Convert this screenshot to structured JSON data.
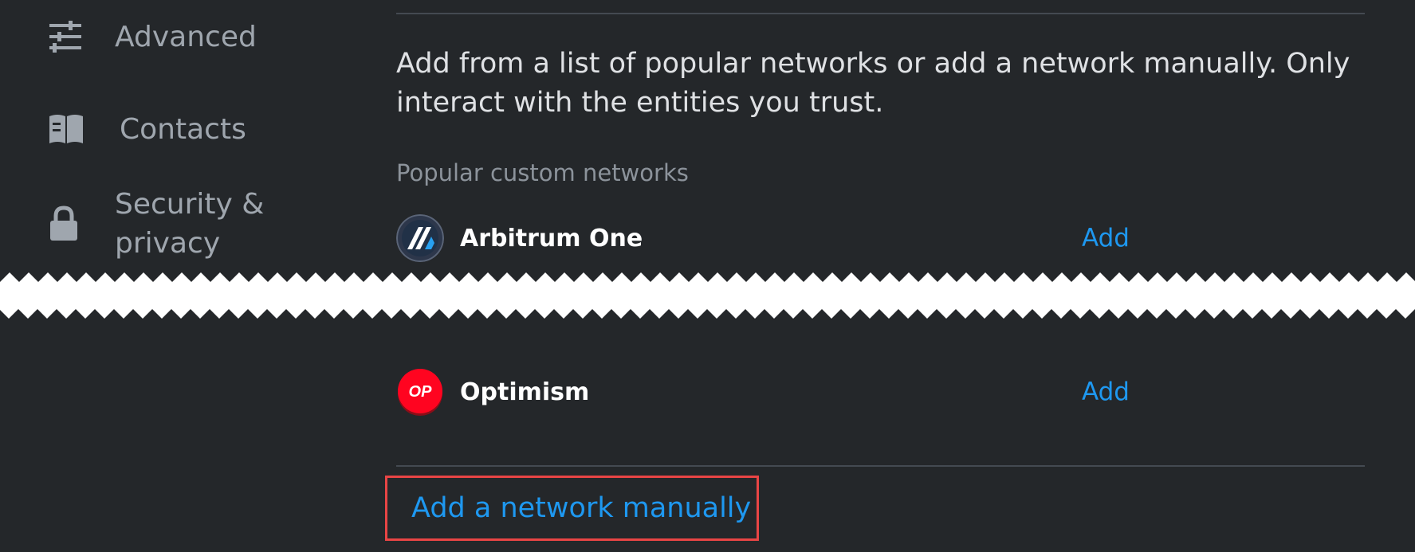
{
  "sidebar": {
    "items": [
      {
        "label": "Advanced",
        "icon": "sliders-icon"
      },
      {
        "label": "Contacts",
        "icon": "book-icon"
      },
      {
        "label_line1": "Security &",
        "label_line2": "privacy",
        "icon": "lock-icon"
      }
    ]
  },
  "main": {
    "intro": "Add from a list of popular networks or add a network manually. Only interact with the entities you trust.",
    "section_label": "Popular custom networks",
    "networks": [
      {
        "name": "Arbitrum One",
        "action": "Add",
        "icon": "arbitrum-logo"
      },
      {
        "name": "Optimism",
        "action": "Add",
        "icon": "optimism-logo",
        "logo_text": "OP"
      }
    ],
    "manual_link": "Add a network manually"
  },
  "colors": {
    "background": "#24272a",
    "link": "#1e98f0",
    "highlight_border": "#e94545",
    "sidebar_text": "#9fa6ae"
  }
}
